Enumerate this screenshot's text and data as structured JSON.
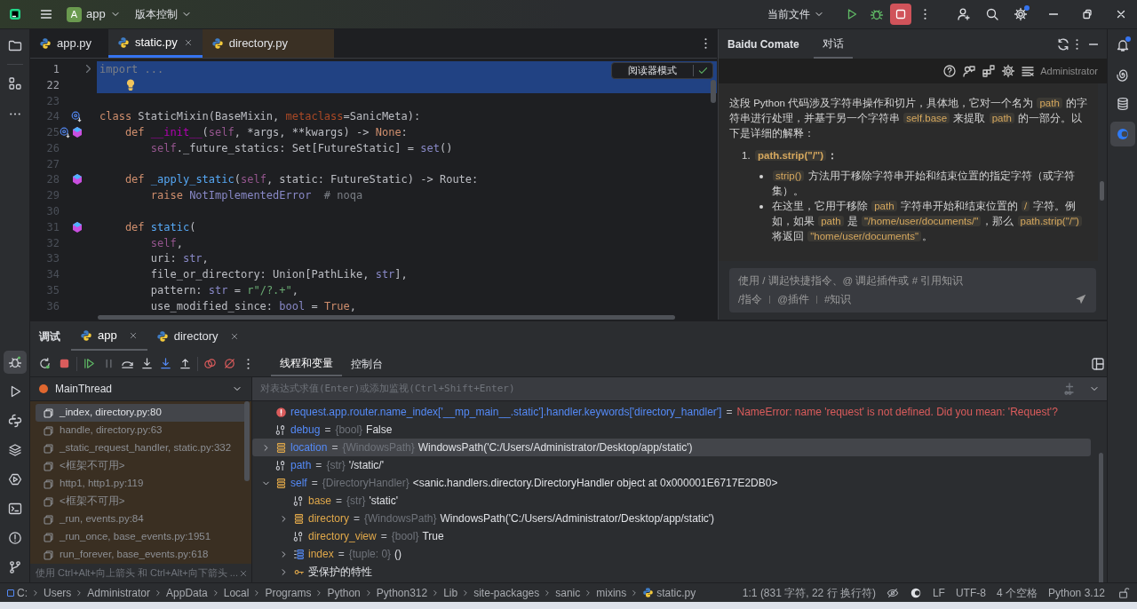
{
  "titlebar": {
    "project_badge": "A",
    "project": "app",
    "vcs": "版本控制",
    "run_config": "当前文件",
    "stop_active": true
  },
  "editor_tabs": [
    {
      "label": "app.py",
      "selected": false,
      "library": false,
      "closable": false
    },
    {
      "label": "static.py",
      "selected": true,
      "library": false,
      "closable": true
    },
    {
      "label": "directory.py",
      "selected": false,
      "library": true,
      "closable": false
    }
  ],
  "reader_mode": "阅读器模式",
  "code_lines": [
    {
      "number": "1",
      "fold": true,
      "selected": true,
      "tokens": [
        {
          "kind": "folded",
          "text": "import ..."
        }
      ]
    },
    {
      "number": "22",
      "selected": true,
      "bulb": true
    },
    {
      "number": "23"
    },
    {
      "number": "24",
      "overridden": true,
      "tokens": [
        {
          "kind": "kw",
          "text": "class"
        },
        {
          "kind": "plain",
          "text": " StaticMixin(BaseMixin, "
        },
        {
          "kind": "param",
          "text": "metaclass"
        },
        {
          "kind": "plain",
          "text": "=SanicMeta):"
        }
      ]
    },
    {
      "number": "25",
      "overridden": true,
      "implements": true,
      "tokens": [
        {
          "kind": "kw",
          "text": "    def"
        },
        {
          "kind": "dunder",
          "text": " __init__"
        },
        {
          "kind": "plain",
          "text": "("
        },
        {
          "kind": "self",
          "text": "self"
        },
        {
          "kind": "plain",
          "text": ", *args, **kwargs) -> "
        },
        {
          "kind": "kw",
          "text": "None"
        },
        {
          "kind": "plain",
          "text": ":"
        }
      ]
    },
    {
      "number": "26",
      "tokens": [
        {
          "kind": "self",
          "text": "        self"
        },
        {
          "kind": "plain",
          "text": "._future_statics: Set[FutureStatic] = "
        },
        {
          "kind": "builtin",
          "text": "set"
        },
        {
          "kind": "plain",
          "text": "()"
        }
      ]
    },
    {
      "number": "27"
    },
    {
      "number": "28",
      "implements": true,
      "tokens": [
        {
          "kind": "kw",
          "text": "    def"
        },
        {
          "kind": "fn",
          "text": " _apply_static"
        },
        {
          "kind": "plain",
          "text": "("
        },
        {
          "kind": "self",
          "text": "self"
        },
        {
          "kind": "plain",
          "text": ", static: FutureStatic) -> Route:"
        }
      ]
    },
    {
      "number": "29",
      "tokens": [
        {
          "kind": "kw",
          "text": "        raise"
        },
        {
          "kind": "builtin",
          "text": " NotImplementedError"
        },
        {
          "kind": "comment",
          "text": "  # noqa"
        }
      ]
    },
    {
      "number": "30"
    },
    {
      "number": "31",
      "implements": true,
      "tokens": [
        {
          "kind": "kw",
          "text": "    def"
        },
        {
          "kind": "fn",
          "text": " static"
        },
        {
          "kind": "plain",
          "text": "("
        }
      ]
    },
    {
      "number": "32",
      "tokens": [
        {
          "kind": "self",
          "text": "        self"
        },
        {
          "kind": "plain",
          "text": ","
        }
      ]
    },
    {
      "number": "33",
      "tokens": [
        {
          "kind": "plain",
          "text": "        uri: "
        },
        {
          "kind": "builtin",
          "text": "str"
        },
        {
          "kind": "plain",
          "text": ","
        }
      ]
    },
    {
      "number": "34",
      "tokens": [
        {
          "kind": "plain",
          "text": "        file_or_directory: Union[PathLike, "
        },
        {
          "kind": "builtin",
          "text": "str"
        },
        {
          "kind": "plain",
          "text": "],"
        }
      ]
    },
    {
      "number": "35",
      "tokens": [
        {
          "kind": "plain",
          "text": "        pattern: "
        },
        {
          "kind": "builtin",
          "text": "str"
        },
        {
          "kind": "plain",
          "text": " = "
        },
        {
          "kind": "str",
          "text": "r\"/?.+\""
        },
        {
          "kind": "plain",
          "text": ","
        }
      ]
    },
    {
      "number": "36",
      "tokens": [
        {
          "kind": "plain",
          "text": "        use_modified_since: "
        },
        {
          "kind": "builtin",
          "text": "bool"
        },
        {
          "kind": "plain",
          "text": " = "
        },
        {
          "kind": "kw",
          "text": "True"
        },
        {
          "kind": "plain",
          "text": ","
        }
      ]
    }
  ],
  "chat": {
    "title": "Baidu Comate",
    "tabs": [
      {
        "label": "对话",
        "selected": true
      }
    ],
    "user": "Administrator",
    "paragraph": [
      {
        "kind": "text",
        "text": "这段 Python 代码涉及字符串操作和切片，具体地，它对一个名为 "
      },
      {
        "kind": "code",
        "text": "path"
      },
      {
        "kind": "text",
        "text": " 的字符串进行处理，并基于另一个字符串 "
      },
      {
        "kind": "code",
        "text": "self.base"
      },
      {
        "kind": "text",
        "text": " 来提取 "
      },
      {
        "kind": "code",
        "text": "path"
      },
      {
        "kind": "text",
        "text": " 的一部分。以下是详细的解释："
      }
    ],
    "list_number": "1.",
    "list_heading": [
      {
        "kind": "code",
        "text": "path.strip(\"/\")"
      },
      {
        "kind": "text",
        "text": "："
      }
    ],
    "bullets": [
      [
        {
          "kind": "code",
          "text": "strip()"
        },
        {
          "kind": "text",
          "text": " 方法用于移除字符串开始和结束位置的指定字符（或字符集）。"
        }
      ],
      [
        {
          "kind": "text",
          "text": "在这里，它用于移除 "
        },
        {
          "kind": "code",
          "text": "path"
        },
        {
          "kind": "text",
          "text": " 字符串开始和结束位置的 "
        },
        {
          "kind": "code",
          "text": "/"
        },
        {
          "kind": "text",
          "text": " 字符。例如，如果 "
        },
        {
          "kind": "code",
          "text": "path"
        },
        {
          "kind": "text",
          "text": " 是 "
        },
        {
          "kind": "code",
          "text": "\"/home/user/documents/\""
        },
        {
          "kind": "text",
          "text": "，那么 "
        },
        {
          "kind": "code",
          "text": "path.strip(\"/\")"
        },
        {
          "kind": "text",
          "text": " 将返回 "
        },
        {
          "kind": "code",
          "text": "\"home/user/documents\""
        },
        {
          "kind": "text",
          "text": "。"
        }
      ]
    ],
    "input_placeholder": "使用 / 调起快捷指令、@ 调起插件或 # 引用知识",
    "shortcuts": [
      "/指令",
      "@插件",
      "#知识"
    ]
  },
  "debug": {
    "title": "调试",
    "tabs": [
      {
        "label": "app",
        "selected": true
      },
      {
        "label": "directory",
        "selected": false
      }
    ],
    "subtabs": [
      {
        "label": "线程和变量",
        "selected": true
      },
      {
        "label": "控制台",
        "selected": false
      }
    ],
    "thread": "MainThread",
    "eval_placeholder": "对表达式求值(Enter)或添加监视(Ctrl+Shift+Enter)",
    "frames": [
      {
        "label": "_index, directory.py:80",
        "selected": true
      },
      {
        "label": "handle, directory.py:63",
        "selected": false
      },
      {
        "label": "_static_request_handler, static.py:332",
        "selected": false
      },
      {
        "label": "<框架不可用>",
        "selected": false
      },
      {
        "label": "http1, http1.py:119",
        "selected": false
      },
      {
        "label": "<框架不可用>",
        "selected": false
      },
      {
        "label": "_run, events.py:84",
        "selected": false
      },
      {
        "label": "_run_once, base_events.py:1951",
        "selected": false
      },
      {
        "label": "run_forever, base_events.py:618",
        "selected": false
      }
    ],
    "hint": "使用 Ctrl+Alt+向上箭头 和 Ctrl+Alt+向下箭头 ...",
    "variables": [
      {
        "kind": "error",
        "name": "request.app.router.name_index['__mp_main__.static'].handler.keywords['directory_handler']",
        "eq": "=",
        "value": "NameError: name 'request' is not defined. Did you mean: 'Request'?"
      },
      {
        "kind": "primitive",
        "name": "debug",
        "eq": "=",
        "type": "{bool}",
        "value": "False"
      },
      {
        "kind": "object",
        "name": "location",
        "eq": "=",
        "type": "{WindowsPath}",
        "value": "WindowsPath('C:/Users/Administrator/Desktop/app/static')",
        "expanded": false,
        "selected": true
      },
      {
        "kind": "primitive",
        "name": "path",
        "eq": "=",
        "type": "{str}",
        "value": "'/static/'"
      },
      {
        "kind": "object",
        "name": "self",
        "eq": "=",
        "type": "{DirectoryHandler}",
        "value": "<sanic.handlers.directory.DirectoryHandler object at 0x000001E6717E2DB0>",
        "expanded": true,
        "children": [
          {
            "kind": "primitive",
            "name": "base",
            "eq": "=",
            "type": "{str}",
            "value": "'static'"
          },
          {
            "kind": "object",
            "name": "directory",
            "eq": "=",
            "type": "{WindowsPath}",
            "value": "WindowsPath('C:/Users/Administrator/Desktop/app/static')",
            "expanded": false
          },
          {
            "kind": "primitive",
            "name": "directory_view",
            "eq": "=",
            "type": "{bool}",
            "value": "True"
          },
          {
            "kind": "tuple",
            "name": "index",
            "eq": "=",
            "type": "{tuple: 0}",
            "value": "()",
            "expanded": false
          },
          {
            "kind": "protected",
            "name": "受保护的特性",
            "expanded": false
          }
        ]
      }
    ]
  },
  "status_bar": {
    "breadcrumbs": [
      "C:",
      "Users",
      "Administrator",
      "AppData",
      "Local",
      "Programs",
      "Python",
      "Python312",
      "Lib",
      "site-packages",
      "sanic",
      "mixins"
    ],
    "file": "static.py",
    "position": "1:1 (831 字符, 22 行 换行符)",
    "line_ending": "LF",
    "encoding": "UTF-8",
    "indent": "4 个空格",
    "interpreter": "Python 3.12"
  }
}
